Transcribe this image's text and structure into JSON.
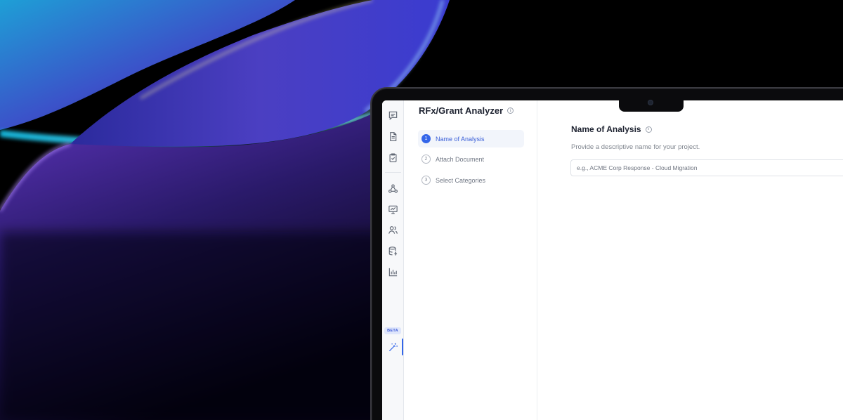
{
  "app": {
    "title": "RFx/Grant Analyzer"
  },
  "rail": {
    "beta_label": "BETA",
    "icons": [
      "chat-icon",
      "document-icon",
      "clipboard-check-icon",
      "network-icon",
      "presentation-icon",
      "users-icon",
      "database-icon",
      "bar-chart-icon",
      "magic-wand-icon"
    ]
  },
  "steps": [
    {
      "number": "1",
      "label": "Name of Analysis",
      "active": true
    },
    {
      "number": "2",
      "label": "Attach Document",
      "active": false
    },
    {
      "number": "3",
      "label": "Select Categories",
      "active": false
    }
  ],
  "main": {
    "section_title": "Name of Analysis",
    "description": "Provide a descriptive name for your project.",
    "input_placeholder": "e.g., ACME Corp Response - Cloud Migration",
    "input_value": ""
  },
  "colors": {
    "accent": "#3466e9",
    "text_primary": "#1d2230",
    "text_muted": "#80868f"
  }
}
